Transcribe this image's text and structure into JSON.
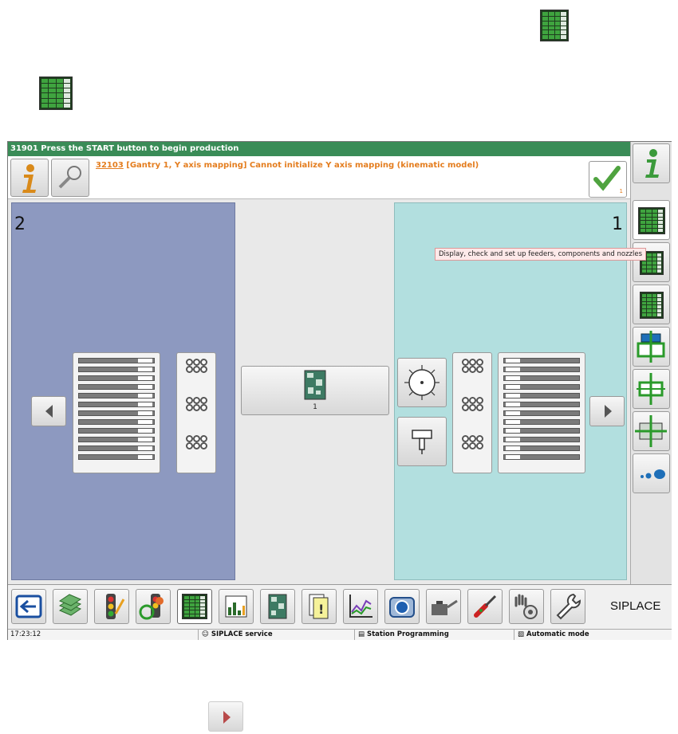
{
  "header": {
    "status_message": "31901 Press the START button to begin production"
  },
  "message": {
    "code": "32103",
    "text": " [Gantry 1, Y axis mapping] Cannot initialize Y axis mapping (kinematic model)",
    "ack_count": "1"
  },
  "panels": {
    "left_gantry": "2",
    "right_gantry": "1"
  },
  "board": {
    "count": "1"
  },
  "tooltip": {
    "text": "Display, check and set up feeders, components and nozzles"
  },
  "taskbar": {
    "brand": "SIPLACE"
  },
  "statusbar": {
    "time": "17:23:12",
    "user": "SIPLACE service",
    "station": "Station Programming",
    "mode": "Automatic mode"
  },
  "icons": {
    "info": "info-icon",
    "search": "magnifier-icon",
    "ack": "check-icon",
    "feeders": "feeder-grid-icon",
    "prev": "arrow-left-icon",
    "next": "arrow-right-icon"
  },
  "colors": {
    "header": "#3a8c57",
    "message": "#e47d1e",
    "left_panel": "#8d99c0",
    "right_panel": "#b2dfdf",
    "tooltip": "#fde9e9"
  }
}
